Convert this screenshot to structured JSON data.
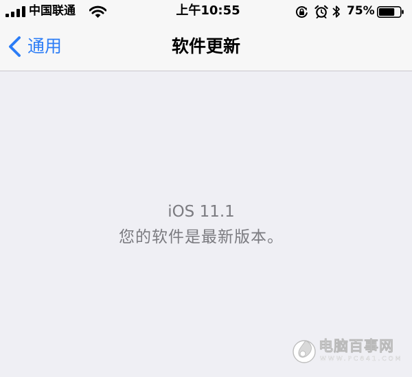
{
  "status_bar": {
    "carrier": "中国联通",
    "time": "上午10:55",
    "battery_percent_text": "75%",
    "battery_level": 0.75,
    "signal_bars": 4,
    "icons": [
      "signal-icon",
      "wifi-icon",
      "rotation-lock-icon",
      "alarm-icon",
      "bluetooth-icon",
      "battery-icon"
    ]
  },
  "nav": {
    "back_label": "通用",
    "title": "软件更新"
  },
  "content": {
    "version": "iOS 11.1",
    "message": "您的软件是最新版本。"
  },
  "watermark": {
    "text": "电脑百事网",
    "url": "WWW.PC841.COM"
  },
  "colors": {
    "accent": "#2c7df6",
    "background": "#efeff4",
    "nav_background": "#f7f7f7",
    "secondary_text": "#7b7b80",
    "separator": "#c8c7cc"
  }
}
